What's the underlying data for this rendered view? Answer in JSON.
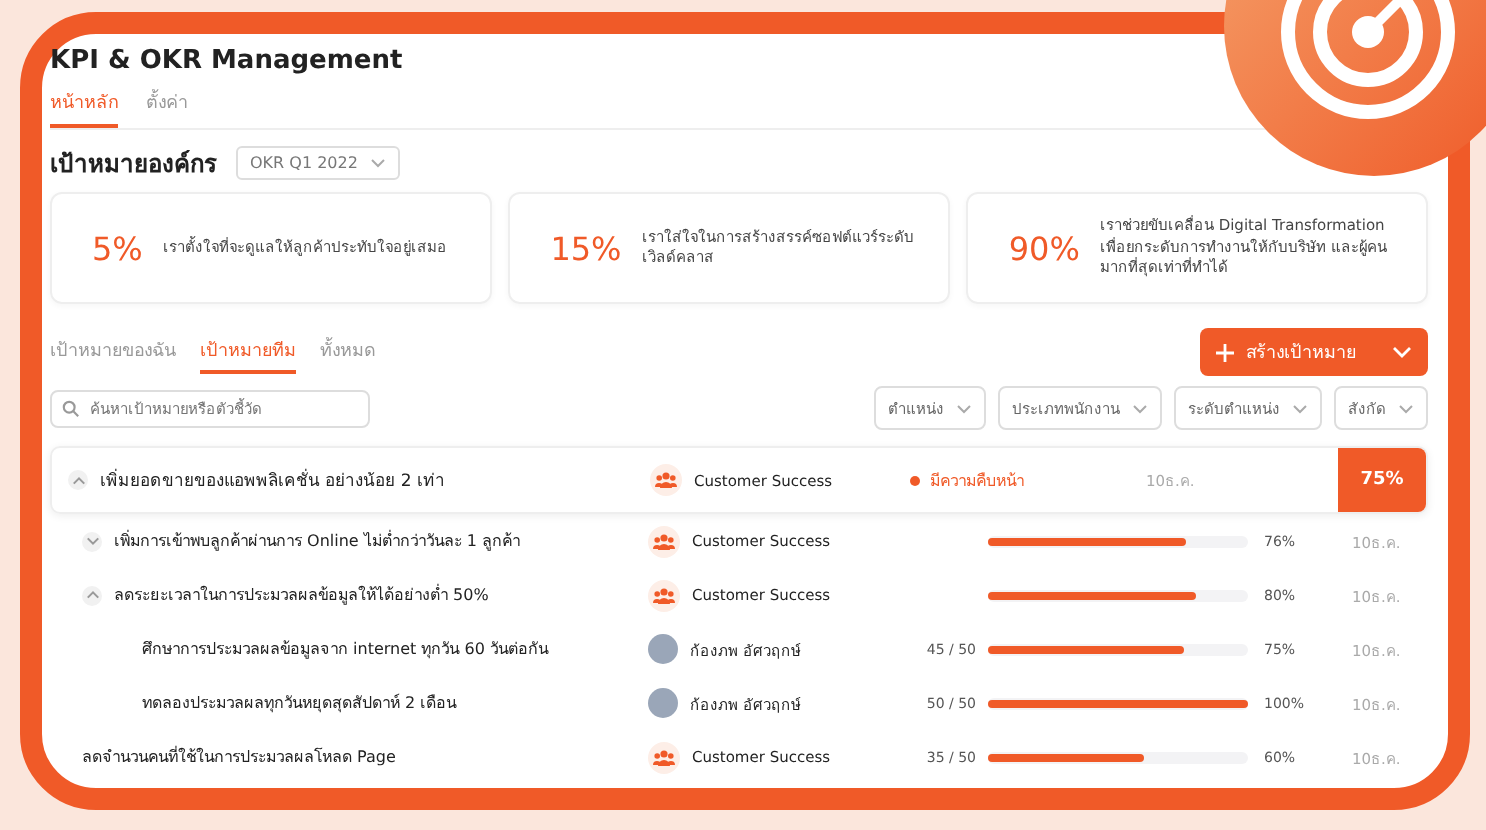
{
  "app": {
    "title": "KPI & OKR Management"
  },
  "nav_tabs": [
    {
      "label": "หน้าหลัก",
      "selected": true
    },
    {
      "label": "ตั้งค่า",
      "selected": false
    }
  ],
  "org_goals": {
    "title": "เป้าหมายองค์กร",
    "period": "OKR Q1 2022",
    "cards": [
      {
        "percent": "5%",
        "text": "เราตั้งใจที่จะดูแลให้ลูกค้าประทับใจอยู่เสมอ"
      },
      {
        "percent": "15%",
        "text": "เราใส่ใจในการสร้างสรรค์ซอฟต์แวร์ระดับเวิลด์คลาส"
      },
      {
        "percent": "90%",
        "text": "เราช่วยขับเคลื่อน Digital Transformation เพื่อยกระดับการทำงานให้กับบริษัท และผู้คนมากที่สุดเท่าที่ทำได้"
      }
    ]
  },
  "goal_tabs": [
    {
      "label": "เป้าหมายของฉัน",
      "selected": false
    },
    {
      "label": "เป้าหมายทีม",
      "selected": true
    },
    {
      "label": "ทั้งหมด",
      "selected": false
    }
  ],
  "search": {
    "placeholder": "ค้นหาเป้าหมายหรือตัวชี้วัด"
  },
  "create_button": {
    "label": "สร้างเป้าหมาย"
  },
  "filters": [
    "ตำแหน่ง",
    "ประเภทพนักงาน",
    "ระดับตำแหน่ง",
    "สังกัด"
  ],
  "goals": [
    {
      "kind": "team",
      "title": "เพิ่มยอดขายของแอพพลิเคชั่น อย่างน้อย 2 เท่า",
      "expanded": true,
      "owner": "Customer Success",
      "status": "มีความคืบหน้า",
      "due": "10ธ.ค.",
      "score": "75%",
      "children": [
        {
          "kind": "team",
          "title": "เพิ่มการเข้าพบลูกค้าผ่านการ Online ไม่ต่ำกว่าวันละ 1 ลูกค้า",
          "expanded": false,
          "owner": "Customer Success",
          "level": 0.76,
          "percent": "76%",
          "due": "10ธ.ค."
        },
        {
          "kind": "team",
          "title": "ลดระยะเวลาในการประมวลผลข้อมูลให้ได้อย่างต่ำ 50%",
          "expanded": true,
          "owner": "Customer Success",
          "level": 0.8,
          "percent": "80%",
          "due": "10ธ.ค.",
          "children": [
            {
              "kind": "person",
              "title": "ศึกษาการประมวลผลข้อมูลจาก internet ทุกวัน 60 วันต่อกัน",
              "owner": "ก้องภพ อัศวฤกษ์",
              "progress": "45 / 50",
              "level": 0.75,
              "percent": "75%",
              "due": "10ธ.ค."
            },
            {
              "kind": "person",
              "title": "ทดลองประมวลผลทุกวันหยุดสุดสัปดาห์ 2 เดือน",
              "owner": "ก้องภพ อัศวฤกษ์",
              "progress": "50 / 50",
              "level": 1.0,
              "percent": "100%",
              "due": "10ธ.ค."
            }
          ]
        },
        {
          "kind": "team",
          "title": "ลดจำนวนคนที่ใช้ในการประมวลผลโหลด Page",
          "owner": "Customer Success",
          "progress": "35 / 50",
          "level": 0.6,
          "percent": "60%",
          "due": "10ธ.ค."
        }
      ]
    }
  ]
}
